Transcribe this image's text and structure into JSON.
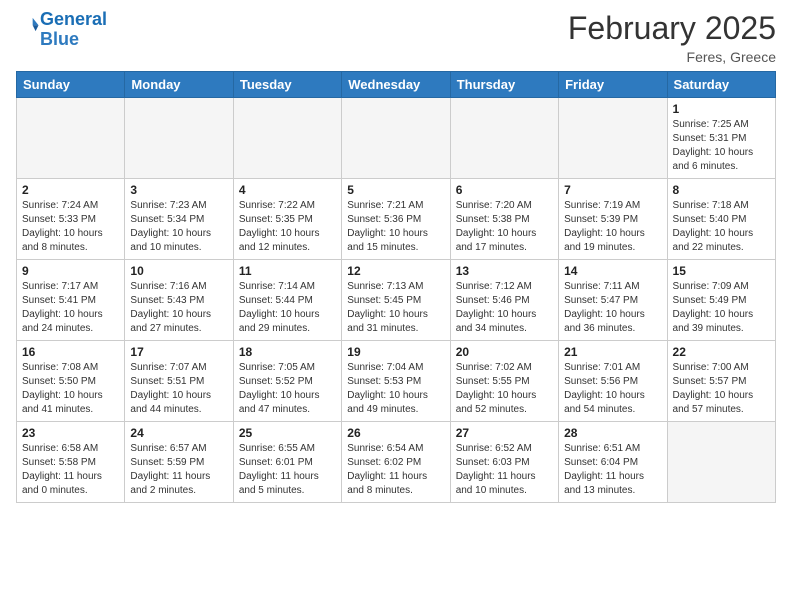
{
  "header": {
    "logo_general": "General",
    "logo_blue": "Blue",
    "month_title": "February 2025",
    "location": "Feres, Greece"
  },
  "weekdays": [
    "Sunday",
    "Monday",
    "Tuesday",
    "Wednesday",
    "Thursday",
    "Friday",
    "Saturday"
  ],
  "weeks": [
    [
      {
        "day": "",
        "info": ""
      },
      {
        "day": "",
        "info": ""
      },
      {
        "day": "",
        "info": ""
      },
      {
        "day": "",
        "info": ""
      },
      {
        "day": "",
        "info": ""
      },
      {
        "day": "",
        "info": ""
      },
      {
        "day": "1",
        "info": "Sunrise: 7:25 AM\nSunset: 5:31 PM\nDaylight: 10 hours\nand 6 minutes."
      }
    ],
    [
      {
        "day": "2",
        "info": "Sunrise: 7:24 AM\nSunset: 5:33 PM\nDaylight: 10 hours\nand 8 minutes."
      },
      {
        "day": "3",
        "info": "Sunrise: 7:23 AM\nSunset: 5:34 PM\nDaylight: 10 hours\nand 10 minutes."
      },
      {
        "day": "4",
        "info": "Sunrise: 7:22 AM\nSunset: 5:35 PM\nDaylight: 10 hours\nand 12 minutes."
      },
      {
        "day": "5",
        "info": "Sunrise: 7:21 AM\nSunset: 5:36 PM\nDaylight: 10 hours\nand 15 minutes."
      },
      {
        "day": "6",
        "info": "Sunrise: 7:20 AM\nSunset: 5:38 PM\nDaylight: 10 hours\nand 17 minutes."
      },
      {
        "day": "7",
        "info": "Sunrise: 7:19 AM\nSunset: 5:39 PM\nDaylight: 10 hours\nand 19 minutes."
      },
      {
        "day": "8",
        "info": "Sunrise: 7:18 AM\nSunset: 5:40 PM\nDaylight: 10 hours\nand 22 minutes."
      }
    ],
    [
      {
        "day": "9",
        "info": "Sunrise: 7:17 AM\nSunset: 5:41 PM\nDaylight: 10 hours\nand 24 minutes."
      },
      {
        "day": "10",
        "info": "Sunrise: 7:16 AM\nSunset: 5:43 PM\nDaylight: 10 hours\nand 27 minutes."
      },
      {
        "day": "11",
        "info": "Sunrise: 7:14 AM\nSunset: 5:44 PM\nDaylight: 10 hours\nand 29 minutes."
      },
      {
        "day": "12",
        "info": "Sunrise: 7:13 AM\nSunset: 5:45 PM\nDaylight: 10 hours\nand 31 minutes."
      },
      {
        "day": "13",
        "info": "Sunrise: 7:12 AM\nSunset: 5:46 PM\nDaylight: 10 hours\nand 34 minutes."
      },
      {
        "day": "14",
        "info": "Sunrise: 7:11 AM\nSunset: 5:47 PM\nDaylight: 10 hours\nand 36 minutes."
      },
      {
        "day": "15",
        "info": "Sunrise: 7:09 AM\nSunset: 5:49 PM\nDaylight: 10 hours\nand 39 minutes."
      }
    ],
    [
      {
        "day": "16",
        "info": "Sunrise: 7:08 AM\nSunset: 5:50 PM\nDaylight: 10 hours\nand 41 minutes."
      },
      {
        "day": "17",
        "info": "Sunrise: 7:07 AM\nSunset: 5:51 PM\nDaylight: 10 hours\nand 44 minutes."
      },
      {
        "day": "18",
        "info": "Sunrise: 7:05 AM\nSunset: 5:52 PM\nDaylight: 10 hours\nand 47 minutes."
      },
      {
        "day": "19",
        "info": "Sunrise: 7:04 AM\nSunset: 5:53 PM\nDaylight: 10 hours\nand 49 minutes."
      },
      {
        "day": "20",
        "info": "Sunrise: 7:02 AM\nSunset: 5:55 PM\nDaylight: 10 hours\nand 52 minutes."
      },
      {
        "day": "21",
        "info": "Sunrise: 7:01 AM\nSunset: 5:56 PM\nDaylight: 10 hours\nand 54 minutes."
      },
      {
        "day": "22",
        "info": "Sunrise: 7:00 AM\nSunset: 5:57 PM\nDaylight: 10 hours\nand 57 minutes."
      }
    ],
    [
      {
        "day": "23",
        "info": "Sunrise: 6:58 AM\nSunset: 5:58 PM\nDaylight: 11 hours\nand 0 minutes."
      },
      {
        "day": "24",
        "info": "Sunrise: 6:57 AM\nSunset: 5:59 PM\nDaylight: 11 hours\nand 2 minutes."
      },
      {
        "day": "25",
        "info": "Sunrise: 6:55 AM\nSunset: 6:01 PM\nDaylight: 11 hours\nand 5 minutes."
      },
      {
        "day": "26",
        "info": "Sunrise: 6:54 AM\nSunset: 6:02 PM\nDaylight: 11 hours\nand 8 minutes."
      },
      {
        "day": "27",
        "info": "Sunrise: 6:52 AM\nSunset: 6:03 PM\nDaylight: 11 hours\nand 10 minutes."
      },
      {
        "day": "28",
        "info": "Sunrise: 6:51 AM\nSunset: 6:04 PM\nDaylight: 11 hours\nand 13 minutes."
      },
      {
        "day": "",
        "info": ""
      }
    ]
  ]
}
